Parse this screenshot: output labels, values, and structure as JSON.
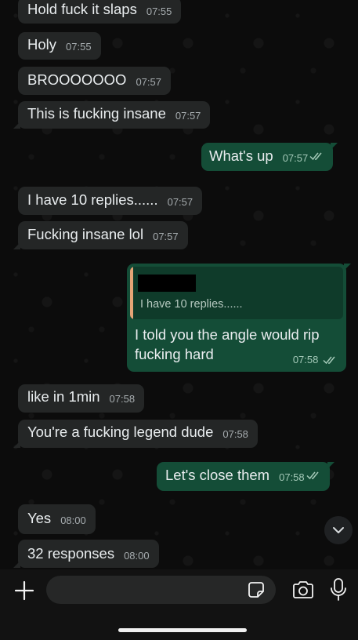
{
  "messages": [
    {
      "text": "Hold fuck it slaps",
      "time": "07:55"
    },
    {
      "text": "Holy",
      "time": "07:55"
    },
    {
      "text": "BROOOOOOO",
      "time": "07:57"
    },
    {
      "text": "This is fucking insane",
      "time": "07:57"
    },
    {
      "text": "What's up",
      "time": "07:57"
    },
    {
      "text": "I have 10 replies......",
      "time": "07:57"
    },
    {
      "text": "Fucking insane lol",
      "time": "07:57"
    },
    {
      "text": "like in 1min",
      "time": "07:58"
    },
    {
      "text": "You're a fucking legend dude",
      "time": "07:58"
    },
    {
      "text": "Let's close them",
      "time": "07:58"
    },
    {
      "text": "Yes",
      "time": "08:00"
    },
    {
      "text": "32 responses",
      "time": "08:00"
    }
  ],
  "reply": {
    "quoted_text": "I have 10 replies......",
    "text": "I told you the angle would rip fucking hard",
    "time": "07:58"
  },
  "input": {
    "placeholder": ""
  },
  "icons": {
    "add": "plus-icon",
    "sticker": "sticker-icon",
    "camera": "camera-icon",
    "mic": "microphone-icon",
    "scroll": "chevron-down-icon",
    "read": "double-check-icon"
  },
  "colors": {
    "incoming_bubble": "#242626",
    "outgoing_bubble": "#144d37",
    "quote_accent": "#e5a476",
    "read_ticks": "#a4c9b8"
  }
}
